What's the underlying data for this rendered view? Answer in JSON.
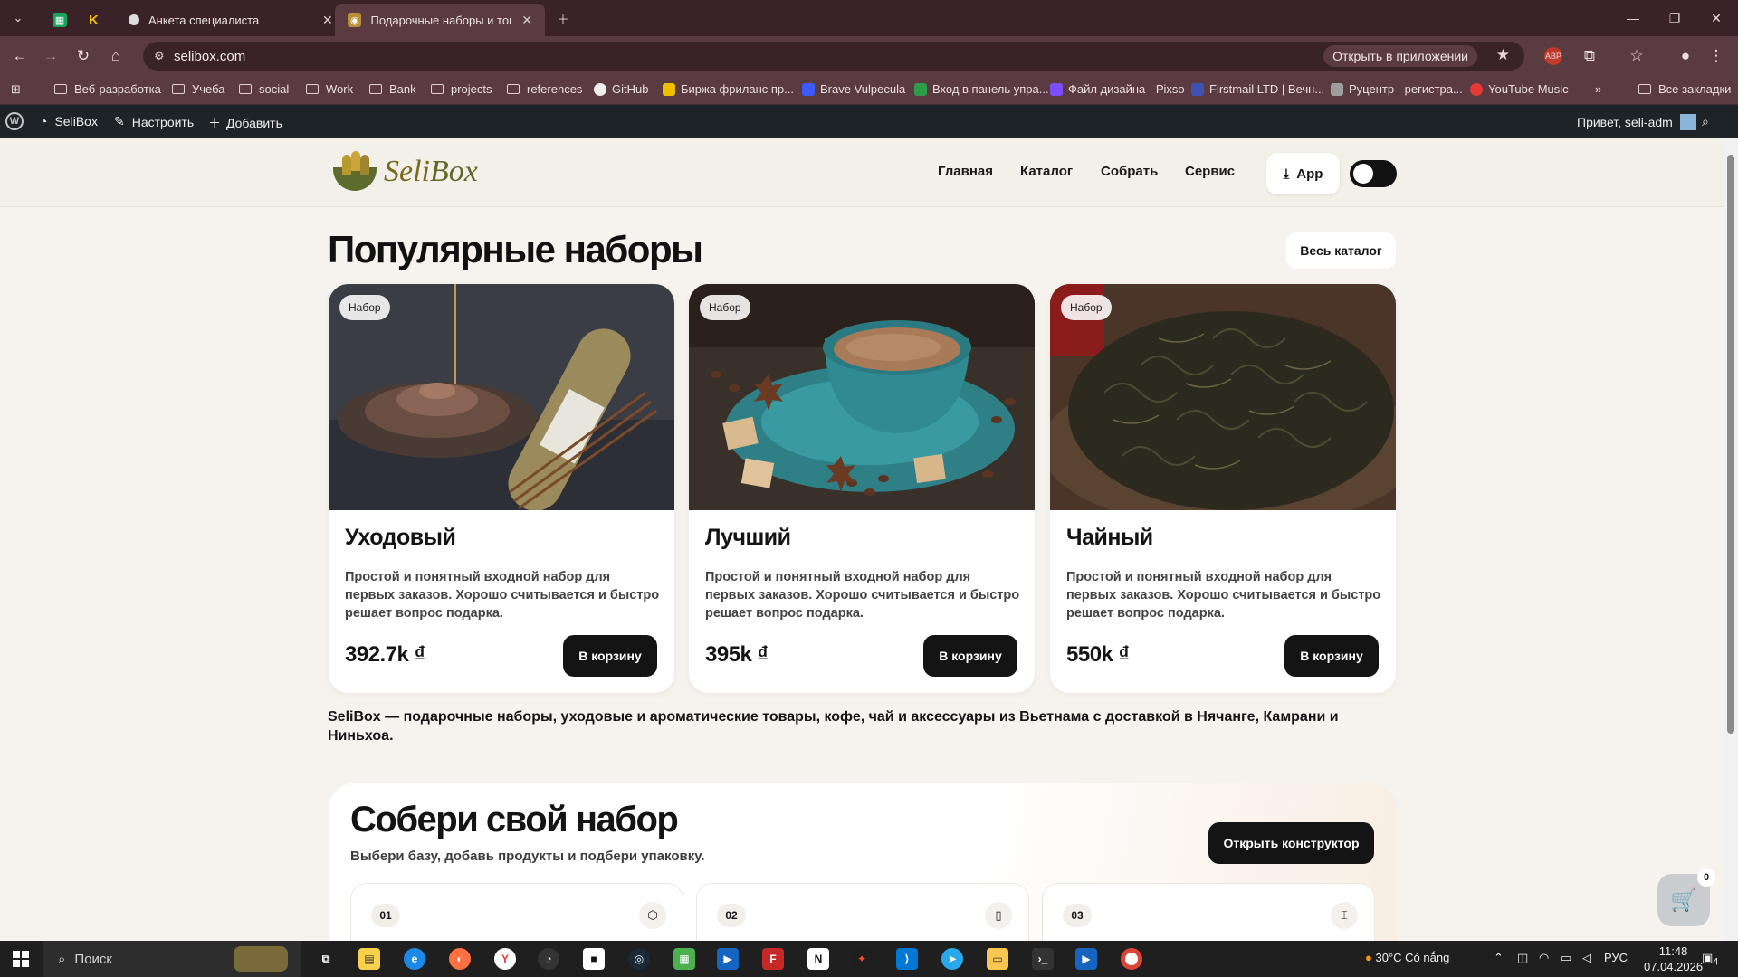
{
  "browser": {
    "tabs": [
      {
        "title": "Анкета специалиста"
      },
      {
        "title": "Подарочные наборы и товары"
      }
    ],
    "url": "selibox.com",
    "open_in_app": "Открыть в приложении",
    "bookmarks": [
      "Веб-разработка",
      "Учеба",
      "social",
      "Work",
      "Bank",
      "projects",
      "references",
      "GitHub",
      "Биржа фриланс пр...",
      "Brave Vulpecula",
      "Вход в панель упра...",
      "Файл дизайна - Pixso",
      "Firstmail LTD | Вечн...",
      "Руцентр - регистра...",
      "YouTube Music"
    ],
    "all_bookmarks": "Все закладки"
  },
  "wp_admin": {
    "site": "SeliBox",
    "customize": "Настроить",
    "add": "Добавить",
    "greeting": "Привет, seli-adm"
  },
  "site": {
    "logo_text_a": "Seli",
    "logo_text_b": "Box",
    "nav": [
      "Главная",
      "Каталог",
      "Собрать",
      "Сервис"
    ],
    "app_label": "App"
  },
  "popular": {
    "title": "Популярные наборы",
    "catalog_button": "Весь каталог",
    "cards": [
      {
        "badge": "Набор",
        "title": "Уходовый",
        "desc": "Простой и понятный входной набор для первых заказов. Хорошо считывается и быстро решает вопрос подарка.",
        "price": "392.7k ₫",
        "button": "В корзину"
      },
      {
        "badge": "Набор",
        "title": "Лучший",
        "desc": "Простой и понятный входной набор для первых заказов. Хорошо считывается и быстро решает вопрос подарка.",
        "price": "395k ₫",
        "button": "В корзину"
      },
      {
        "badge": "Набор",
        "title": "Чайный",
        "desc": "Простой и понятный входной набор для первых заказов. Хорошо считывается и быстро решает вопрос подарка.",
        "price": "550k ₫",
        "button": "В корзину"
      }
    ]
  },
  "seo_text": "SeliBox — подарочные наборы, уходовые и ароматические товары, кофе, чай и аксессуары из Вьетнама с доставкой в Нячанге, Камрани и Ниньхоа.",
  "constructor": {
    "title": "Собери свой набор",
    "subtitle": "Выбери базу, добавь продукты и подбери упаковку.",
    "button": "Открыть конструктор",
    "steps": [
      "01",
      "02",
      "03"
    ]
  },
  "cart": {
    "count": "0"
  },
  "taskbar": {
    "search": "Поиск",
    "weather": "30°C",
    "weather_text": "Có nắng",
    "lang": "РУС",
    "time": "11:48",
    "date": "07.04.2026",
    "notifications": "4"
  }
}
